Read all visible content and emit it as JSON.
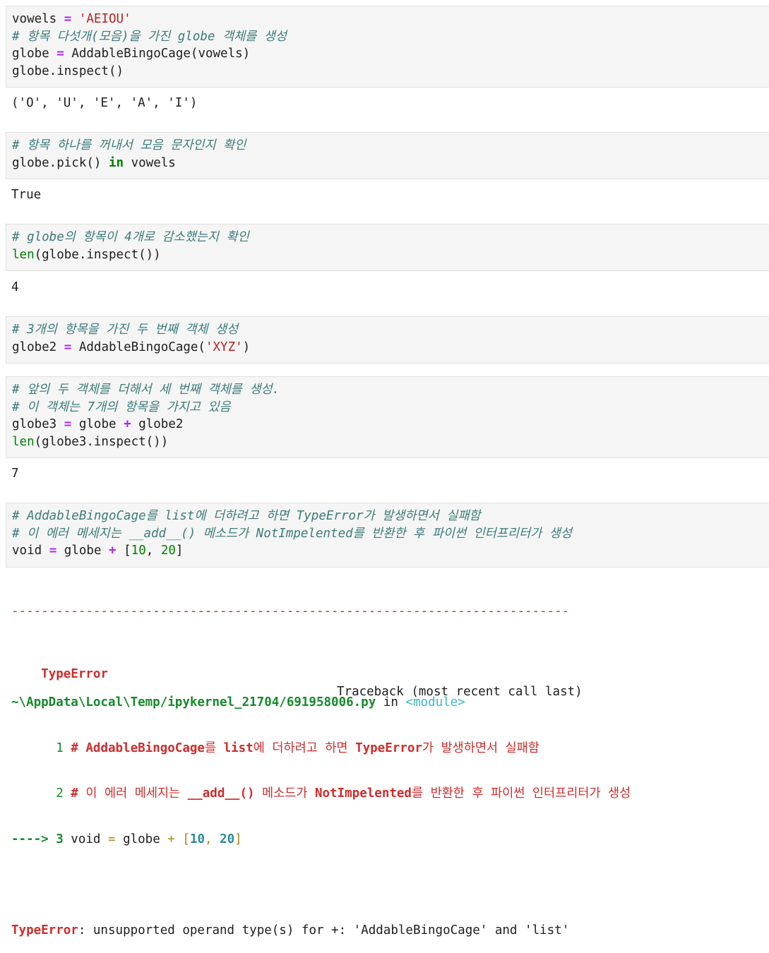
{
  "cells": [
    {
      "code": {
        "line1": {
          "var": "vowels",
          "eq": "=",
          "str": "'AEIOU'"
        },
        "line2": {
          "comment": "# 항목 다섯개(모음)을 가진 globe 객체를 생성"
        },
        "line3": {
          "var": "globe",
          "eq": "=",
          "call": "AddableBingoCage(vowels)"
        },
        "line4": {
          "text": "globe.inspect()"
        }
      },
      "output": "('O', 'U', 'E', 'A', 'I')"
    },
    {
      "code": {
        "line1": {
          "comment": "# 항목 하나를 꺼내서 모음 문자인지 확인"
        },
        "line2": {
          "pre": "globe.pick() ",
          "kw": "in",
          "post": " vowels"
        }
      },
      "output": "True"
    },
    {
      "code": {
        "line1": {
          "comment": "# globe의 항목이 4개로 감소했는지 확인"
        },
        "line2": {
          "fn": "len",
          "rest": "(globe.inspect())"
        }
      },
      "output": "4"
    },
    {
      "code": {
        "line1": {
          "comment": "# 3개의 항목을 가진 두 번째 객체 생성"
        },
        "line2": {
          "var": "globe2",
          "eq": "=",
          "call": "AddableBingoCage(",
          "str": "'XYZ'",
          "close": ")"
        }
      }
    },
    {
      "code": {
        "line1": {
          "comment": "# 앞의 두 객체를 더해서 세 번째 객체를 생성."
        },
        "line2": {
          "comment": "# 이 객체는 7개의 항목을 가지고 있음"
        },
        "line3": {
          "var": "globe3",
          "eq": "=",
          "a": "globe",
          "plus": "+",
          "b": "globe2"
        },
        "line4": {
          "fn": "len",
          "rest": "(globe3.inspect())"
        }
      },
      "output": "7"
    },
    {
      "code": {
        "line1": {
          "comment": "# AddableBingoCage를 list에 더하려고 하면 TypeError가 발생하면서 실패함"
        },
        "line2": {
          "comment": "# 이 에러 메세지는 __add__() 메소드가 NotImpelented를 반환한 후 파이썬 인터프리터가 생성"
        },
        "line3": {
          "var": "void",
          "eq": "=",
          "a": "globe",
          "plus": "+",
          "open": "[",
          "n1": "10",
          "comma": ", ",
          "n2": "20",
          "close": "]"
        }
      }
    }
  ],
  "traceback": {
    "dashes": "---------------------------------------------------------------------------",
    "error_name": "TypeError",
    "header_right": "Traceback (most recent call last)",
    "file_path": "~\\AppData\\Local\\Temp/ipykernel_21704/691958006.py",
    "in_word": " in ",
    "module": "<module>",
    "l1": {
      "num": "      1 ",
      "p1": "# AddableBingoCage",
      "p2": "를 ",
      "p3": "list",
      "p4": "에 더하려고 하면 ",
      "p5": "TypeError",
      "p6": "가 발생하면서 실패함"
    },
    "l2": {
      "num": "      2 ",
      "p1": "# ",
      "p2": "이 에러 메세지는 ",
      "p3": "__add__()",
      "p4": " 메소드가 ",
      "p5": "NotImpelented",
      "p6": "를 반환한 후 파이썬 인터프리터가 생성"
    },
    "l3": {
      "arrow": "----> 3 ",
      "pre": "void ",
      "eq": "=",
      "mid": " globe ",
      "plus": "+",
      "sp": " ",
      "open": "[",
      "n1": "10",
      "comma": ", ",
      "n2": "20",
      "close": "]"
    },
    "final_name": "TypeError",
    "final_msg": ": unsupported operand type(s) for +: 'AddableBingoCage' and 'list'"
  }
}
